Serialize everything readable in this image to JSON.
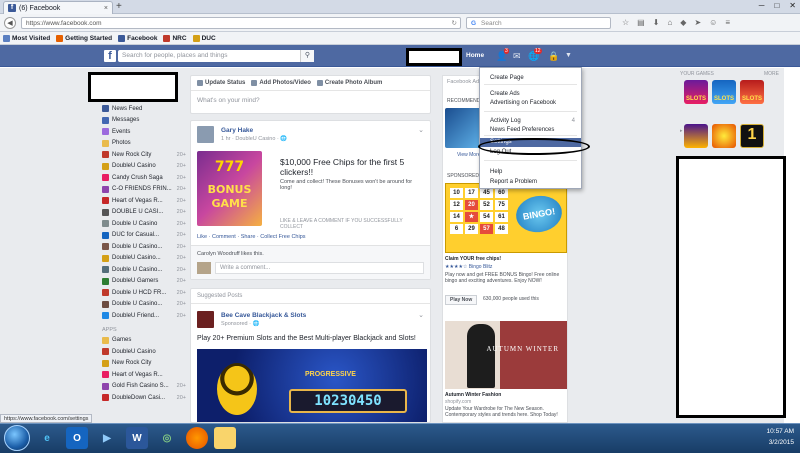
{
  "browser": {
    "tab_title": "(6) Facebook",
    "url": "https://www.facebook.com",
    "search_placeholder": "Search",
    "bookmarks": [
      "Most Visited",
      "Getting Started",
      "Facebook",
      "NRC",
      "DUC"
    ],
    "status_url": "https://www.facebook.com/settings"
  },
  "fb_header": {
    "search_placeholder": "Search for people, places and things",
    "home": "Home",
    "friend_badge": "3",
    "notif_badge": "12"
  },
  "left_nav": {
    "favorites": [
      {
        "label": "News Feed",
        "count": ""
      },
      {
        "label": "Messages",
        "count": ""
      },
      {
        "label": "Events",
        "count": ""
      },
      {
        "label": "Photos",
        "count": ""
      },
      {
        "label": "New Rock City",
        "count": "20+"
      },
      {
        "label": "DoubleU Casino",
        "count": "20+"
      },
      {
        "label": "Candy Crush Saga",
        "count": "20+"
      },
      {
        "label": "C-O FRIENDS FRIN...",
        "count": "20+"
      },
      {
        "label": "Heart of Vegas R...",
        "count": "20+"
      },
      {
        "label": "DOUBLE U CASI...",
        "count": "20+"
      },
      {
        "label": "Double U Casino",
        "count": "20+"
      },
      {
        "label": "DUC for Casual...",
        "count": "20+"
      },
      {
        "label": "Double U Casino...",
        "count": "20+"
      },
      {
        "label": "DoubleU Casino...",
        "count": "20+"
      },
      {
        "label": "Double U Casino...",
        "count": "20+"
      },
      {
        "label": "DoubleU Gamers",
        "count": "20+"
      },
      {
        "label": "Double U HCD FR...",
        "count": "20+"
      },
      {
        "label": "Double U Casino...",
        "count": "20+"
      },
      {
        "label": "DoubleU Friend...",
        "count": "20+"
      }
    ],
    "apps_heading": "APPS",
    "apps": [
      {
        "label": "Games",
        "count": ""
      },
      {
        "label": "DoubleU Casino",
        "count": ""
      },
      {
        "label": "New Rock City",
        "count": ""
      },
      {
        "label": "Heart of Vegas R...",
        "count": ""
      },
      {
        "label": "Gold Fish Casino S...",
        "count": "20+"
      },
      {
        "label": "DoubleDown Casi...",
        "count": "20+"
      }
    ]
  },
  "composer": {
    "tabs": [
      "Update Status",
      "Add Photos/Video",
      "Create Photo Album"
    ],
    "placeholder": "What's on your mind?"
  },
  "post": {
    "author": "Gary Hake",
    "meta": "1 hr · DoubleU Casino · 🌐",
    "game_line1": "777",
    "game_line2": "BONUS",
    "game_line3": "GAME",
    "title": "$10,000 Free Chips for the first 5 clickers!!",
    "subtitle": "Come and collect! These Bonuses won't be around for long!",
    "link_caption": "LIKE & LEAVE A COMMENT IF YOU SUCCESSFULLY COLLECT",
    "actions": "Like · Comment · Share · Collect Free Chips",
    "likes": "Carolyn Woodruff likes this.",
    "comment_placeholder": "Write a comment..."
  },
  "suggested": {
    "title": "Suggested Posts",
    "page_name": "Bee Cave Blackjack & Slots",
    "meta": "Sponsored · 🌐",
    "text": "Play 20+ Premium Slots and the Best Multi-player Blackjack and Slots!",
    "progressive": "PROGRESSIVE",
    "jackpot": "10230450"
  },
  "right_col": {
    "top_label": "Facebook Ads",
    "recommended": "RECOMMENDED GAMES",
    "view_more": "View More",
    "sponsored": "SPONSORED",
    "bingo_numbers": [
      "10",
      "17",
      "45",
      "60",
      "12",
      "20",
      "52",
      "75",
      "14",
      "★",
      "54",
      "61",
      "6",
      "29",
      "57",
      "48"
    ],
    "bingo_logo": "BINGO!",
    "bingo_title": "Claim YOUR free chips!",
    "bingo_rating": "★★★★☆ Bingo Blitz",
    "bingo_desc": "Play now and get FREE BONUS Bingo! Free online bingo and exciting adventures. Enjoy NOW!",
    "play_now": "Play Now",
    "play_count": "630,000 people used this",
    "fashion_overlay": "AUTUMN WINTER",
    "fashion_title": "Autumn Winter Fashion",
    "fashion_url": "shopify.com",
    "fashion_desc": "Update Your Wardrobe for The New Season. Contemporary styles and trends here. Shop Today!"
  },
  "dropdown": {
    "items": [
      {
        "label": "Create Page"
      },
      {
        "label": "Create Ads"
      },
      {
        "label": "Advertising on Facebook"
      },
      {
        "label": "Activity Log",
        "count": "4"
      },
      {
        "label": "News Feed Preferences"
      },
      {
        "label": "Settings",
        "selected": true
      },
      {
        "label": "Log Out"
      },
      {
        "label": "Help"
      },
      {
        "label": "Report a Problem"
      }
    ]
  },
  "far_right": {
    "your_games": "YOUR GAMES",
    "more": "MORE",
    "game1": "SLOTS",
    "game2": "SLOTS",
    "game3": "SLOTS",
    "game4": "",
    "game5": "",
    "game6": "1"
  },
  "taskbar": {
    "time": "10:57 AM",
    "date": "3/2/2015"
  },
  "colors": {
    "fb_blue": "#4e69a2",
    "fb_dark_blue": "#3b5998",
    "link_blue": "#365899",
    "badge_red": "#e02b2b"
  }
}
